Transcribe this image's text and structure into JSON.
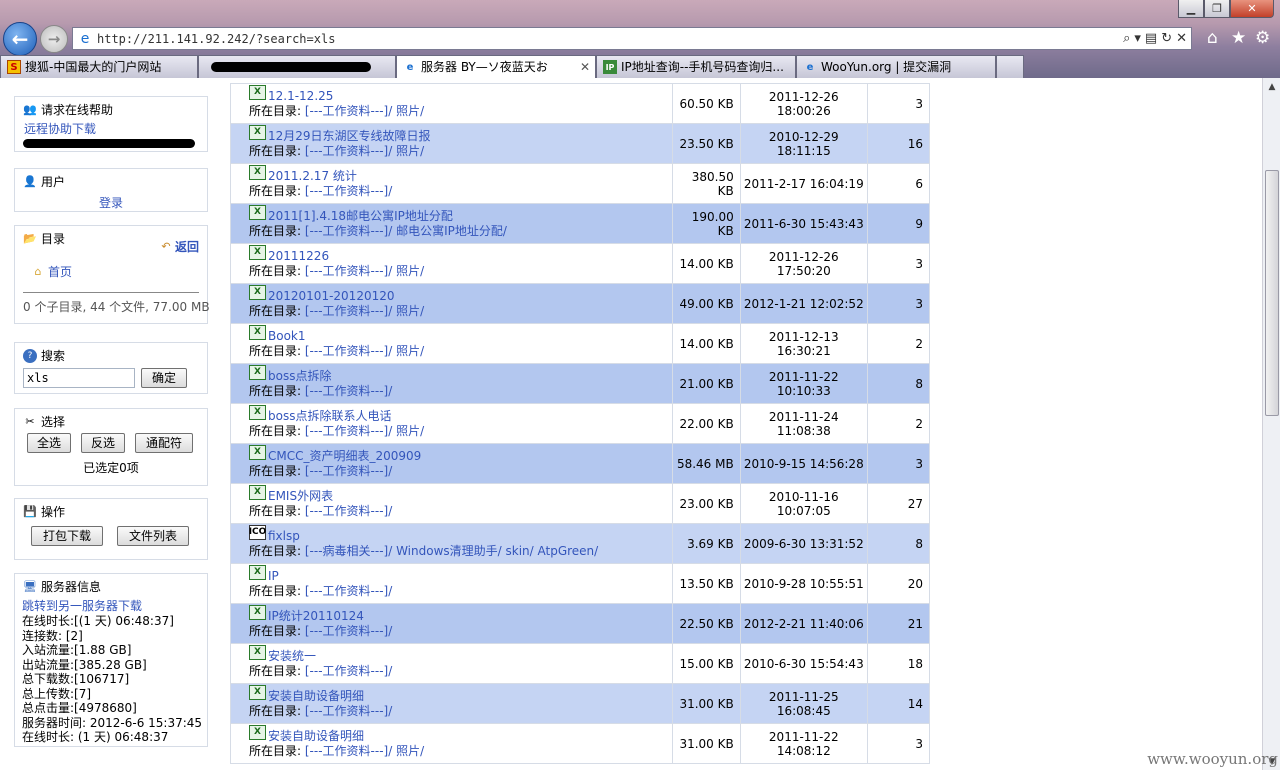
{
  "browser": {
    "url": "http://211.141.92.242/?search=xls",
    "tabs": [
      {
        "label": "搜狐-中国最大的门户网站",
        "icon": "S"
      },
      {
        "label": "",
        "icon": ""
      },
      {
        "label": "服务器 BY—ソ夜蓝天お",
        "icon": "e"
      },
      {
        "label": "IP地址查询--手机号码查询归...",
        "icon": "IP"
      },
      {
        "label": "WooYun.org | 提交漏洞",
        "icon": "e"
      }
    ]
  },
  "sidebar": {
    "help": {
      "title": "请求在线帮助",
      "link": "远程协助下载"
    },
    "user": {
      "title": "用户",
      "login": "登录"
    },
    "dir": {
      "title": "目录",
      "back": "返回",
      "home": "首页",
      "summary": "0 个子目录, 44 个文件, 77.00 MB"
    },
    "search": {
      "title": "搜索",
      "value": "xls",
      "button": "确定"
    },
    "select": {
      "title": "选择",
      "all": "全选",
      "invert": "反选",
      "wildcard": "通配符",
      "status": "已选定0项"
    },
    "ops": {
      "title": "操作",
      "pack": "打包下载",
      "list": "文件列表"
    },
    "server": {
      "title": "服务器信息",
      "link": "跳转到另一服务器下载",
      "lines": [
        "在线时长:[(1 天) 06:48:37]",
        "连接数: [2]",
        "入站流量:[1.88 GB]",
        "出站流量:[385.28 GB]",
        "总下载数:[106717]",
        "总上传数:[7]",
        "总点击量:[4978680]",
        "服务器时间: 2012-6-6 15:37:45",
        "在线时长: (1 天) 06:48:37"
      ]
    }
  },
  "dir_label": "所在目录:",
  "files": [
    {
      "name": "12.1-12.25",
      "dir": "[---工作资料---]/ 照片/",
      "size": "60.50 KB",
      "date": "2011-12-26 18:00:26",
      "count": "3",
      "style": "normal"
    },
    {
      "name": "12月29日东湖区专线故障日报",
      "dir": "[---工作资料---]/ 照片/",
      "size": "23.50 KB",
      "date": "2010-12-29 18:11:15",
      "count": "16",
      "style": "sel"
    },
    {
      "name": "2011.2.17 统计",
      "dir": "[---工作资料---]/",
      "size": "380.50 KB",
      "date": "2011-2-17 16:04:19",
      "count": "6",
      "style": "normal"
    },
    {
      "name": "2011[1].4.18邮电公寓IP地址分配",
      "dir": "[---工作资料---]/ 邮电公寓IP地址分配/",
      "size": "190.00 KB",
      "date": "2011-6-30 15:43:43",
      "count": "9",
      "style": "hl"
    },
    {
      "name": "20111226",
      "dir": "[---工作资料---]/ 照片/",
      "size": "14.00 KB",
      "date": "2011-12-26 17:50:20",
      "count": "3",
      "style": "normal"
    },
    {
      "name": "20120101-20120120",
      "dir": "[---工作资料---]/ 照片/",
      "size": "49.00 KB",
      "date": "2012-1-21 12:02:52",
      "count": "3",
      "style": "hl"
    },
    {
      "name": "Book1",
      "dir": "[---工作资料---]/ 照片/",
      "size": "14.00 KB",
      "date": "2011-12-13 16:30:21",
      "count": "2",
      "style": "normal"
    },
    {
      "name": "boss点拆除",
      "dir": "[---工作资料---]/",
      "size": "21.00 KB",
      "date": "2011-11-22 10:10:33",
      "count": "8",
      "style": "hl"
    },
    {
      "name": "boss点拆除联系人电话",
      "dir": "[---工作资料---]/ 照片/",
      "size": "22.00 KB",
      "date": "2011-11-24 11:08:38",
      "count": "2",
      "style": "normal"
    },
    {
      "name": "CMCC_资产明细表_200909",
      "dir": "[---工作资料---]/",
      "size": "58.46 MB",
      "date": "2010-9-15 14:56:28",
      "count": "3",
      "style": "hl"
    },
    {
      "name": "EMIS外网表",
      "dir": "[---工作资料---]/",
      "size": "23.00 KB",
      "date": "2010-11-16 10:07:05",
      "count": "27",
      "style": "normal"
    },
    {
      "name": "fixlsp",
      "dir": "[---病毒相关---]/ Windows清理助手/ skin/ AtpGreen/",
      "size": "3.69 KB",
      "date": "2009-6-30 13:31:52",
      "count": "8",
      "style": "sel",
      "icon": "ICO"
    },
    {
      "name": "IP",
      "dir": "[---工作资料---]/",
      "size": "13.50 KB",
      "date": "2010-9-28 10:55:51",
      "count": "20",
      "style": "normal"
    },
    {
      "name": "IP统计20110124",
      "dir": "[---工作资料---]/",
      "size": "22.50 KB",
      "date": "2012-2-21 11:40:06",
      "count": "21",
      "style": "hl"
    },
    {
      "name": "安装统一",
      "dir": "[---工作资料---]/",
      "size": "15.00 KB",
      "date": "2010-6-30 15:54:43",
      "count": "18",
      "style": "normal"
    },
    {
      "name": "安装自助设备明细",
      "dir": "[---工作资料---]/",
      "size": "31.00 KB",
      "date": "2011-11-25 16:08:45",
      "count": "14",
      "style": "sel"
    },
    {
      "name": "安装自助设备明细",
      "dir": "[---工作资料---]/ 照片/",
      "size": "31.00 KB",
      "date": "2011-11-22 14:08:12",
      "count": "3",
      "style": "normal"
    }
  ],
  "watermark": "www.wooyun.org"
}
